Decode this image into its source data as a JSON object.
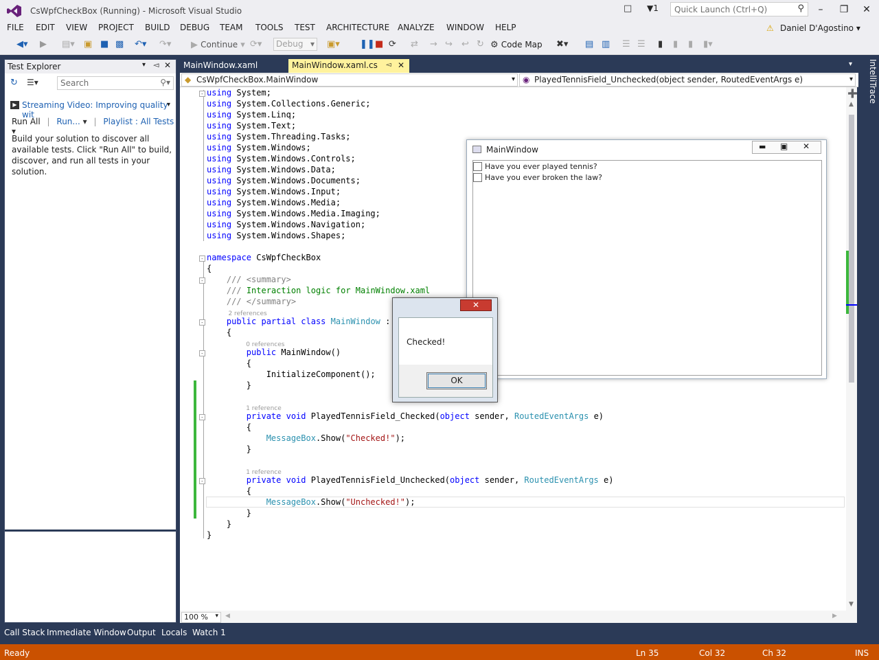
{
  "window": {
    "title": "CsWpfCheckBox (Running) - Microsoft Visual Studio",
    "quick_launch": "Quick Launch (Ctrl+Q)",
    "notif_count": "1"
  },
  "menu": [
    "FILE",
    "EDIT",
    "VIEW",
    "PROJECT",
    "BUILD",
    "DEBUG",
    "TEAM",
    "TOOLS",
    "TEST",
    "ARCHITECTURE",
    "ANALYZE",
    "WINDOW",
    "HELP"
  ],
  "user": "Daniel D'Agostino",
  "toolbar": {
    "continue": "Continue",
    "config": "Debug",
    "code_map": "Code Map"
  },
  "test_explorer": {
    "title": "Test Explorer",
    "search_placeholder": "Search",
    "video_link": "Streaming Video: Improving quality wit",
    "run_all": "Run All",
    "run": "Run...",
    "playlist": "Playlist : All Tests",
    "message": "Build your solution to discover all available tests. Click \"Run All\" to build, discover, and run all tests in your solution."
  },
  "editor": {
    "tabs": [
      "MainWindow.xaml",
      "MainWindow.xaml.cs"
    ],
    "nav_left": "CsWpfCheckBox.MainWindow",
    "nav_right": "PlayedTennisField_Unchecked(object sender, RoutedEventArgs e)",
    "zoom": "100 %",
    "usings": [
      "System",
      "System.Collections.Generic",
      "System.Linq",
      "System.Text",
      "System.Threading.Tasks",
      "System.Windows",
      "System.Windows.Controls",
      "System.Windows.Data",
      "System.Windows.Documents",
      "System.Windows.Input",
      "System.Windows.Media",
      "System.Windows.Media.Imaging",
      "System.Windows.Navigation",
      "System.Windows.Shapes"
    ],
    "namespace": "CsWpfCheckBox",
    "summary_text": "Interaction logic for MainWindow.xaml",
    "refs": {
      "class": "2 references",
      "ctor": "0 references",
      "checked": "1 reference",
      "unchecked": "1 reference"
    },
    "class_name": "MainWindow",
    "ctor_name": "MainWindow()",
    "init_call": "InitializeComponent();",
    "method1": "PlayedTennisField_Checked",
    "method2": "PlayedTennisField_Unchecked",
    "msg1": "\"Checked!\"",
    "msg2": "\"Unchecked!\""
  },
  "intellitrace": "IntelliTrace",
  "app_window": {
    "title": "MainWindow",
    "checkbox1": "Have you ever played tennis?",
    "checkbox2": "Have you ever broken the law?"
  },
  "message_box": {
    "text": "Checked!",
    "ok": "OK"
  },
  "bottom_tabs": [
    "Call Stack",
    "Immediate Window",
    "Output",
    "Locals",
    "Watch 1"
  ],
  "status": {
    "ready": "Ready",
    "ln": "Ln 35",
    "col": "Col 32",
    "ch": "Ch 32",
    "ins": "INS"
  },
  "colors": {
    "status_bar": "#ca5100",
    "chrome": "#2b3a57",
    "active_tab": "#fff29d",
    "keyword": "#0000ff",
    "type": "#2b91af",
    "string": "#a31515",
    "comment": "#008000"
  }
}
